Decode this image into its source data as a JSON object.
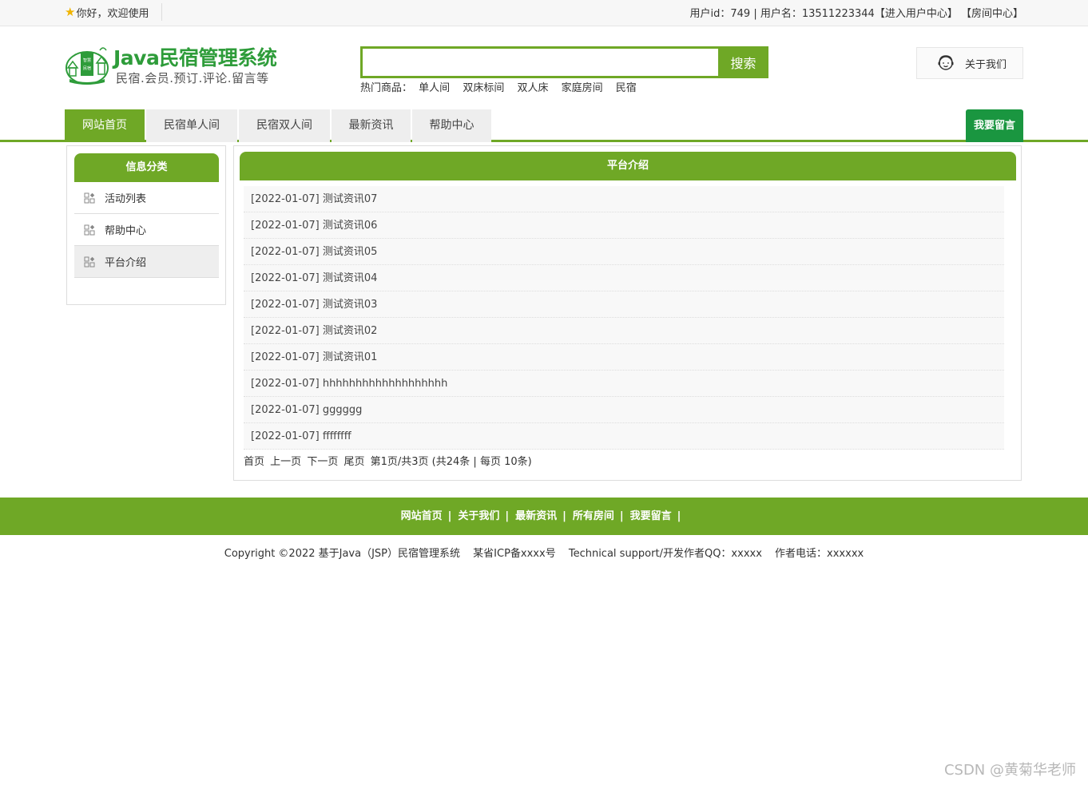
{
  "topbar": {
    "welcome": "你好，欢迎使用",
    "user_info": "用户id：749 | 用户名：13511223344",
    "user_center_link": "【进入用户中心】",
    "room_center_link": "【房间中心】"
  },
  "header": {
    "logo_badge": "智慧民宿",
    "logo_title": "Java民宿管理系统",
    "logo_subtitle": "民宿.会员.预订.评论.留言等",
    "search_placeholder": "",
    "search_button": "搜索",
    "hot_label": "热门商品：",
    "hot_items": [
      "单人间",
      "双床标间",
      "双人床",
      "家庭房间",
      "民宿"
    ],
    "about_us": "关于我们"
  },
  "nav": {
    "tabs": [
      "网站首页",
      "民宿单人间",
      "民宿双人间",
      "最新资讯",
      "帮助中心"
    ],
    "active_index": 0,
    "leave_message": "我要留言"
  },
  "sidebar": {
    "title": "信息分类",
    "items": [
      "活动列表",
      "帮助中心",
      "平台介绍"
    ],
    "active_index": 2
  },
  "main": {
    "title": "平台介绍",
    "news": [
      "[2022-01-07] 测试资讯07",
      "[2022-01-07] 测试资讯06",
      "[2022-01-07] 测试资讯05",
      "[2022-01-07] 测试资讯04",
      "[2022-01-07] 测试资讯03",
      "[2022-01-07] 测试资讯02",
      "[2022-01-07] 测试资讯01",
      "[2022-01-07] hhhhhhhhhhhhhhhhhhh",
      "[2022-01-07] gggggg",
      "[2022-01-07] ffffffff"
    ],
    "pager": {
      "first": "首页",
      "prev": "上一页",
      "next": "下一页",
      "last": "尾页",
      "info": "第1页/共3页 (共24条 | 每页 10条)"
    }
  },
  "footer": {
    "links": [
      "网站首页",
      "关于我们",
      "最新资讯",
      "所有房间",
      "我要留言"
    ],
    "separator": "|",
    "copyright": "Copyright ©2022 基于Java（JSP）民宿管理系统",
    "icp": "某省ICP备xxxx号",
    "support": "Technical support/开发作者QQ：xxxxx",
    "phone": "作者电话：xxxxxx"
  },
  "watermark": "CSDN @黄菊华老师",
  "colors": {
    "accent": "#6fa826",
    "message_button": "#1a9640",
    "logo_green": "#2e9c3a"
  }
}
